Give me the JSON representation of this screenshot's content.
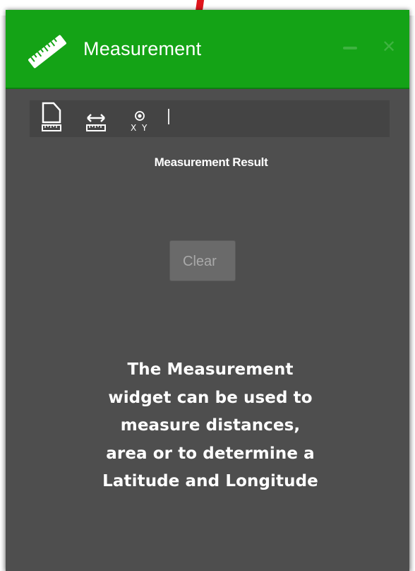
{
  "window": {
    "title": "Measurement",
    "accent_color": "#14a316",
    "panel_color": "#4e4e4e",
    "icon": "ruler-icon"
  },
  "toolbar": {
    "tools": [
      {
        "name": "area",
        "icon": "area-measure-icon"
      },
      {
        "name": "distance",
        "icon": "distance-measure-icon"
      },
      {
        "name": "location",
        "icon": "location-xy-icon"
      }
    ],
    "location_label": "X Y"
  },
  "result": {
    "heading": "Measurement Result"
  },
  "clear_button": {
    "label": "Clear"
  },
  "description": {
    "lines": [
      "The Measurement",
      "widget can be used to",
      "measure distances,",
      "area or to determine a",
      "Latitude and Longitude"
    ]
  }
}
